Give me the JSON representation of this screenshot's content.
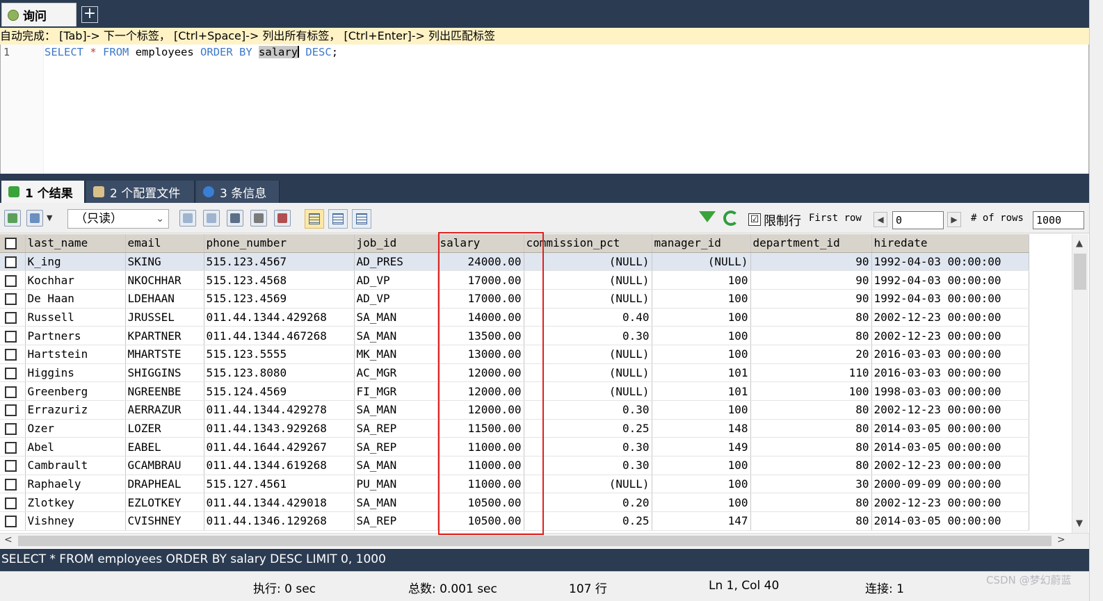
{
  "query_tab": {
    "label": "询问",
    "new_tab": "+"
  },
  "hint": "自动完成： [Tab]-> 下一个标签， [Ctrl+Space]-> 列出所有标签， [Ctrl+Enter]-> 列出匹配标签",
  "editor": {
    "line_number": "1",
    "tokens": {
      "select": "SELECT",
      "star": "*",
      "from": "FROM",
      "table": "employees",
      "order_by": "ORDER BY",
      "column": "salary",
      "desc": "DESC",
      "semicolon": ";"
    }
  },
  "result_tabs": [
    {
      "label": "1 个结果",
      "icon": "table-icon"
    },
    {
      "label": "2 个配置文件",
      "icon": "profile-icon"
    },
    {
      "label": "3 条信息",
      "icon": "info-icon"
    }
  ],
  "toolbar": {
    "mode_select": "（只读）",
    "limit_label": "限制行",
    "limit_checked": "☑",
    "first_row_label": "First row",
    "first_row_value": "0",
    "rows_label": "# of rows",
    "rows_value": "1000"
  },
  "grid": {
    "columns": [
      "last_name",
      "email",
      "phone_number",
      "job_id",
      "salary",
      "commission_pct",
      "manager_id",
      "department_id",
      "hiredate"
    ],
    "rows": [
      [
        "K_ing",
        "SKING",
        "515.123.4567",
        "AD_PRES",
        "24000.00",
        "(NULL)",
        "(NULL)",
        "90",
        "1992-04-03 00:00:00"
      ],
      [
        "Kochhar",
        "NKOCHHAR",
        "515.123.4568",
        "AD_VP",
        "17000.00",
        "(NULL)",
        "100",
        "90",
        "1992-04-03 00:00:00"
      ],
      [
        "De Haan",
        "LDEHAAN",
        "515.123.4569",
        "AD_VP",
        "17000.00",
        "(NULL)",
        "100",
        "90",
        "1992-04-03 00:00:00"
      ],
      [
        "Russell",
        "JRUSSEL",
        "011.44.1344.429268",
        "SA_MAN",
        "14000.00",
        "0.40",
        "100",
        "80",
        "2002-12-23 00:00:00"
      ],
      [
        "Partners",
        "KPARTNER",
        "011.44.1344.467268",
        "SA_MAN",
        "13500.00",
        "0.30",
        "100",
        "80",
        "2002-12-23 00:00:00"
      ],
      [
        "Hartstein",
        "MHARTSTE",
        "515.123.5555",
        "MK_MAN",
        "13000.00",
        "(NULL)",
        "100",
        "20",
        "2016-03-03 00:00:00"
      ],
      [
        "Higgins",
        "SHIGGINS",
        "515.123.8080",
        "AC_MGR",
        "12000.00",
        "(NULL)",
        "101",
        "110",
        "2016-03-03 00:00:00"
      ],
      [
        "Greenberg",
        "NGREENBE",
        "515.124.4569",
        "FI_MGR",
        "12000.00",
        "(NULL)",
        "101",
        "100",
        "1998-03-03 00:00:00"
      ],
      [
        "Errazuriz",
        "AERRAZUR",
        "011.44.1344.429278",
        "SA_MAN",
        "12000.00",
        "0.30",
        "100",
        "80",
        "2002-12-23 00:00:00"
      ],
      [
        "Ozer",
        "LOZER",
        "011.44.1343.929268",
        "SA_REP",
        "11500.00",
        "0.25",
        "148",
        "80",
        "2014-03-05 00:00:00"
      ],
      [
        "Abel",
        "EABEL",
        "011.44.1644.429267",
        "SA_REP",
        "11000.00",
        "0.30",
        "149",
        "80",
        "2014-03-05 00:00:00"
      ],
      [
        "Cambrault",
        "GCAMBRAU",
        "011.44.1344.619268",
        "SA_MAN",
        "11000.00",
        "0.30",
        "100",
        "80",
        "2002-12-23 00:00:00"
      ],
      [
        "Raphaely",
        "DRAPHEAL",
        "515.127.4561",
        "PU_MAN",
        "11000.00",
        "(NULL)",
        "100",
        "30",
        "2000-09-09 00:00:00"
      ],
      [
        "Zlotkey",
        "EZLOTKEY",
        "011.44.1344.429018",
        "SA_MAN",
        "10500.00",
        "0.20",
        "100",
        "80",
        "2002-12-23 00:00:00"
      ],
      [
        "Vishney",
        "CVISHNEY",
        "011.44.1346.129268",
        "SA_REP",
        "10500.00",
        "0.25",
        "147",
        "80",
        "2014-03-05 00:00:00"
      ]
    ]
  },
  "sql_status": "SELECT * FROM employees ORDER BY salary DESC LIMIT 0, 1000",
  "statusbar": {
    "exec": "执行: 0 sec",
    "total": "总数: 0.001 sec",
    "rows": "107 行",
    "cursor": "Ln 1, Col 40",
    "connections": "连接: 1"
  },
  "watermark": "CSDN @梦幻蔚蓝",
  "colors": {
    "chrome_dark": "#2b3b52",
    "hint_bg": "#fff2c5",
    "keyword": "#3d78c9",
    "highlight": "#e02020",
    "header_bg": "#d8d4cc"
  }
}
